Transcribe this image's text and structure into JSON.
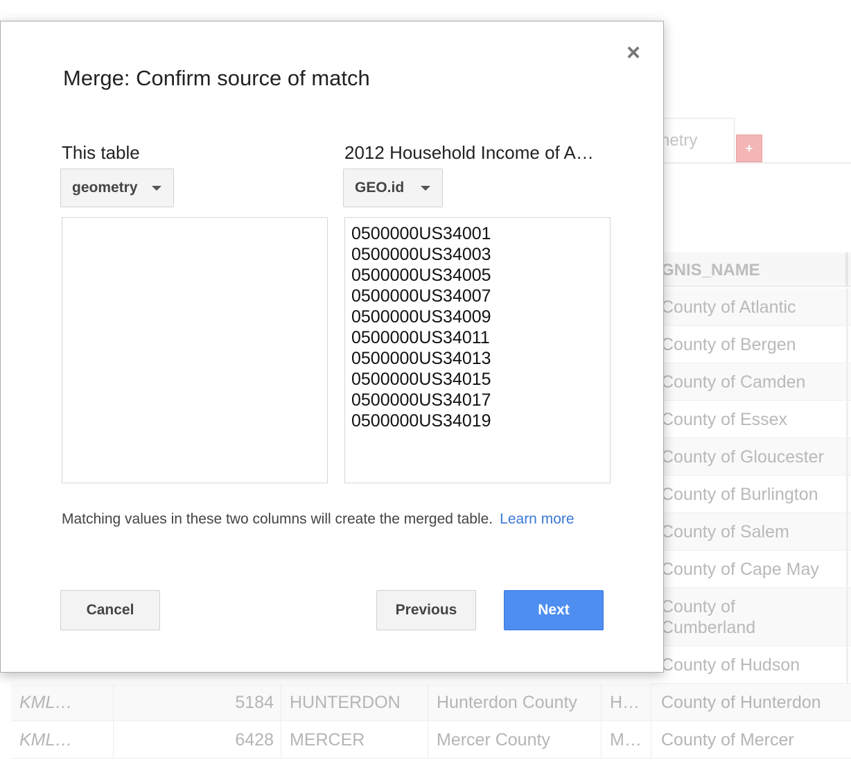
{
  "background": {
    "tab_label": "netry",
    "add_tab_symbol": "+",
    "column_header": "GNIS_NAME",
    "county_rows": [
      "County of Atlantic",
      "County of Bergen",
      "County of Camden",
      "County of Essex",
      "County of Gloucester",
      "County of Burlington",
      "County of Salem",
      "County of Cape May",
      "County of Cumberland",
      "County of Hudson"
    ],
    "bottom_rows": [
      {
        "kml": "KML…",
        "value": "5184",
        "name": "HUNTERDON",
        "county": "Hunterdon County",
        "abbr": "H…",
        "gnis": "County of Hunterdon"
      },
      {
        "kml": "KML…",
        "value": "6428",
        "name": "MERCER",
        "county": "Mercer County",
        "abbr": "M…",
        "gnis": "County of Mercer"
      }
    ]
  },
  "dialog": {
    "title": "Merge: Confirm source of match",
    "close_symbol": "×",
    "left": {
      "label": "This table",
      "dropdown_value": "geometry",
      "values": []
    },
    "right": {
      "label": "2012 Household Income of A…",
      "dropdown_value": "GEO.id",
      "values": [
        "0500000US34001",
        "0500000US34003",
        "0500000US34005",
        "0500000US34007",
        "0500000US34009",
        "0500000US34011",
        "0500000US34013",
        "0500000US34015",
        "0500000US34017",
        "0500000US34019"
      ]
    },
    "hint_text": "Matching values in these two columns will create the merged table.",
    "learn_more": "Learn more",
    "buttons": {
      "cancel": "Cancel",
      "previous": "Previous",
      "next": "Next"
    }
  },
  "colors": {
    "primary_button": "#4d8ef0",
    "link": "#3a78d8",
    "add_tab": "#f3b5b5"
  }
}
